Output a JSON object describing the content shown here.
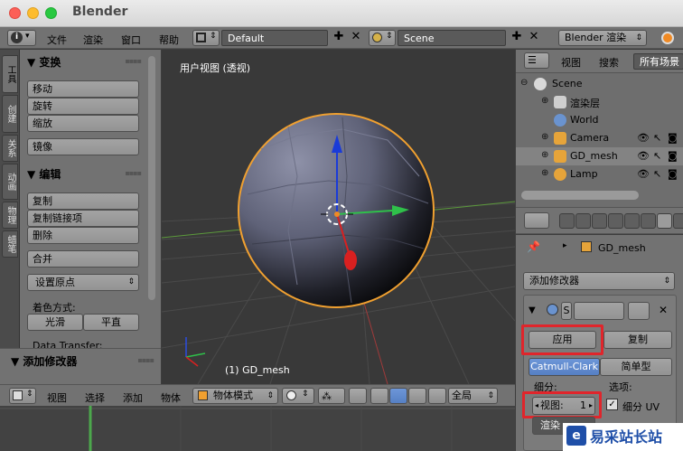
{
  "window": {
    "title": "Blender"
  },
  "top_menu": {
    "items": [
      "文件",
      "渲染",
      "窗口",
      "帮助"
    ],
    "layout": "Default",
    "scene": "Scene",
    "engine": "Blender 渲染"
  },
  "tool_tabs": [
    "工具",
    "创建",
    "关系",
    "动画",
    "物理",
    "蜡笔"
  ],
  "tool_shelf": {
    "transform_title": "变换",
    "transform_buttons": [
      "移动",
      "旋转",
      "缩放"
    ],
    "mirror": "镜像",
    "edit_title": "编辑",
    "edit_buttons": [
      "复制",
      "复制链接项",
      "删除"
    ],
    "join": "合并",
    "origin": "设置原点",
    "shading_label": "着色方式:",
    "smooth": "光滑",
    "flat": "平直",
    "data_transfer": "Data Transfer:",
    "add_modifier_panel": "添加修改器"
  },
  "viewport": {
    "view_label": "用户视图 (透视)",
    "object_label": "(1) GD_mesh"
  },
  "viewport_header": {
    "items": [
      "视图",
      "选择",
      "添加",
      "物体"
    ],
    "mode": "物体模式",
    "pivot": "全局"
  },
  "outliner": {
    "header_items": [
      "视图",
      "搜索"
    ],
    "scope": "所有场景",
    "rows": [
      "Scene",
      "渲染层",
      "World",
      "Camera",
      "GD_mesh",
      "Lamp"
    ]
  },
  "properties": {
    "object": "GD_mesh",
    "add_modifier": "添加修改器",
    "modifier_name_short": "S",
    "apply": "应用",
    "copy": "复制",
    "tab_catmull": "Catmull-Clark",
    "tab_simple": "简单型",
    "subdiv_label": "细分:",
    "options_label": "选项:",
    "view_field": "视图:",
    "view_value": "1",
    "subdiv_uv": "细分 UV",
    "render_field": "渲染"
  },
  "colors": {
    "accent_red": "#e0252b",
    "selected_blue": "#5680c4",
    "outline_orange": "#f0a030"
  }
}
